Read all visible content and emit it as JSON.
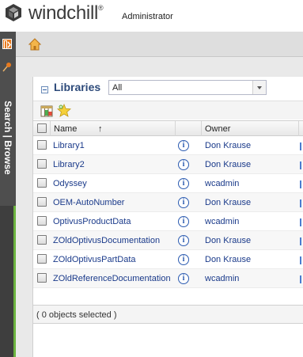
{
  "header": {
    "logo_text": "windchill",
    "logo_mark": "®",
    "user": "Administrator"
  },
  "leftbar": {
    "label": "Search | Browse"
  },
  "panel": {
    "title": "Libraries",
    "filter_value": "All"
  },
  "grid": {
    "columns": [
      "Name",
      "",
      "Owner"
    ],
    "sort_indicator": "↑",
    "rows": [
      {
        "name": "Library1",
        "owner": "Don Krause"
      },
      {
        "name": "Library2",
        "owner": "Don Krause"
      },
      {
        "name": "Odyssey",
        "owner": "wcadmin"
      },
      {
        "name": "OEM-AutoNumber",
        "owner": "Don Krause"
      },
      {
        "name": "OptivusProductData",
        "owner": "wcadmin"
      },
      {
        "name": "ZOldOptivusDocumentation",
        "owner": "Don Krause"
      },
      {
        "name": "ZOldOptivusPartData",
        "owner": "Don Krause"
      },
      {
        "name": "ZOldReferenceDocumentation",
        "owner": "wcadmin"
      }
    ],
    "info_glyph": "i"
  },
  "footer": {
    "status": "( 0 objects selected )"
  },
  "icons": [
    "windchill-logo-icon",
    "expand-panel-icon",
    "pin-icon",
    "home-icon",
    "collapse-icon",
    "table-views-icon",
    "new-library-icon",
    "info-icon"
  ],
  "colors": {
    "brand_green": "#6cb33f",
    "link_blue": "#1a3a8a",
    "accent_orange": "#e87a1e"
  }
}
